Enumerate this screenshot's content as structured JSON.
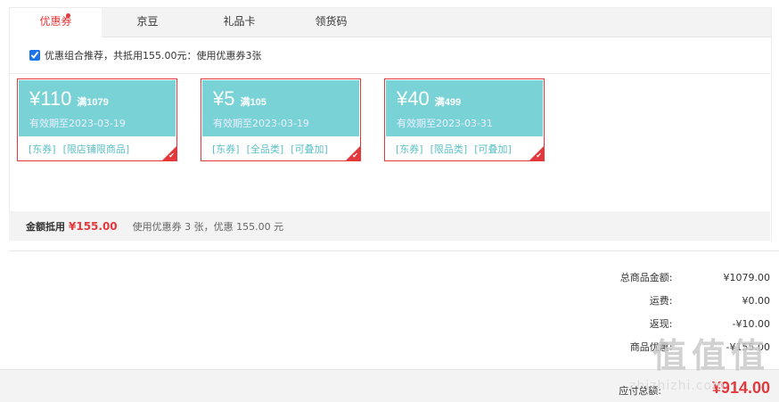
{
  "tabs": [
    {
      "label": "优惠券",
      "active": true
    },
    {
      "label": "京豆",
      "active": false
    },
    {
      "label": "礼品卡",
      "active": false
    },
    {
      "label": "领货码",
      "active": false
    }
  ],
  "recommend": {
    "checked": true,
    "text": "优惠组合推荐，共抵用155.00元：使用优惠券3张"
  },
  "coupons": [
    {
      "amount": "¥110",
      "condition": "满1079",
      "expire": "有效期至2023-03-19",
      "tags": [
        "[东券]",
        "[限店铺限商品]"
      ]
    },
    {
      "amount": "¥5",
      "condition": "满105",
      "expire": "有效期至2023-03-19",
      "tags": [
        "[东券]",
        "[全品类]",
        "[可叠加]"
      ]
    },
    {
      "amount": "¥40",
      "condition": "满499",
      "expire": "有效期至2023-03-31",
      "tags": [
        "[东券]",
        "[限品类]",
        "[可叠加]"
      ]
    }
  ],
  "summary": {
    "label": "金额抵用",
    "amount": "¥155.00",
    "desc": "使用优惠券 3 张，优惠 155.00 元"
  },
  "totals": [
    {
      "k": "总商品金额:",
      "v": "¥1079.00"
    },
    {
      "k": "运费:",
      "v": "¥0.00"
    },
    {
      "k": "返现:",
      "v": "-¥10.00"
    },
    {
      "k": "商品优惠:",
      "v": "-¥155.00"
    }
  ],
  "payable": {
    "k": "应付总额:",
    "v": "¥914.00"
  },
  "watermark": {
    "glyphs": [
      "值",
      "值",
      "值"
    ],
    "url": "zhizhizhi.com"
  },
  "colors": {
    "accent": "#e4393c",
    "coupon": "#79d3d6"
  }
}
